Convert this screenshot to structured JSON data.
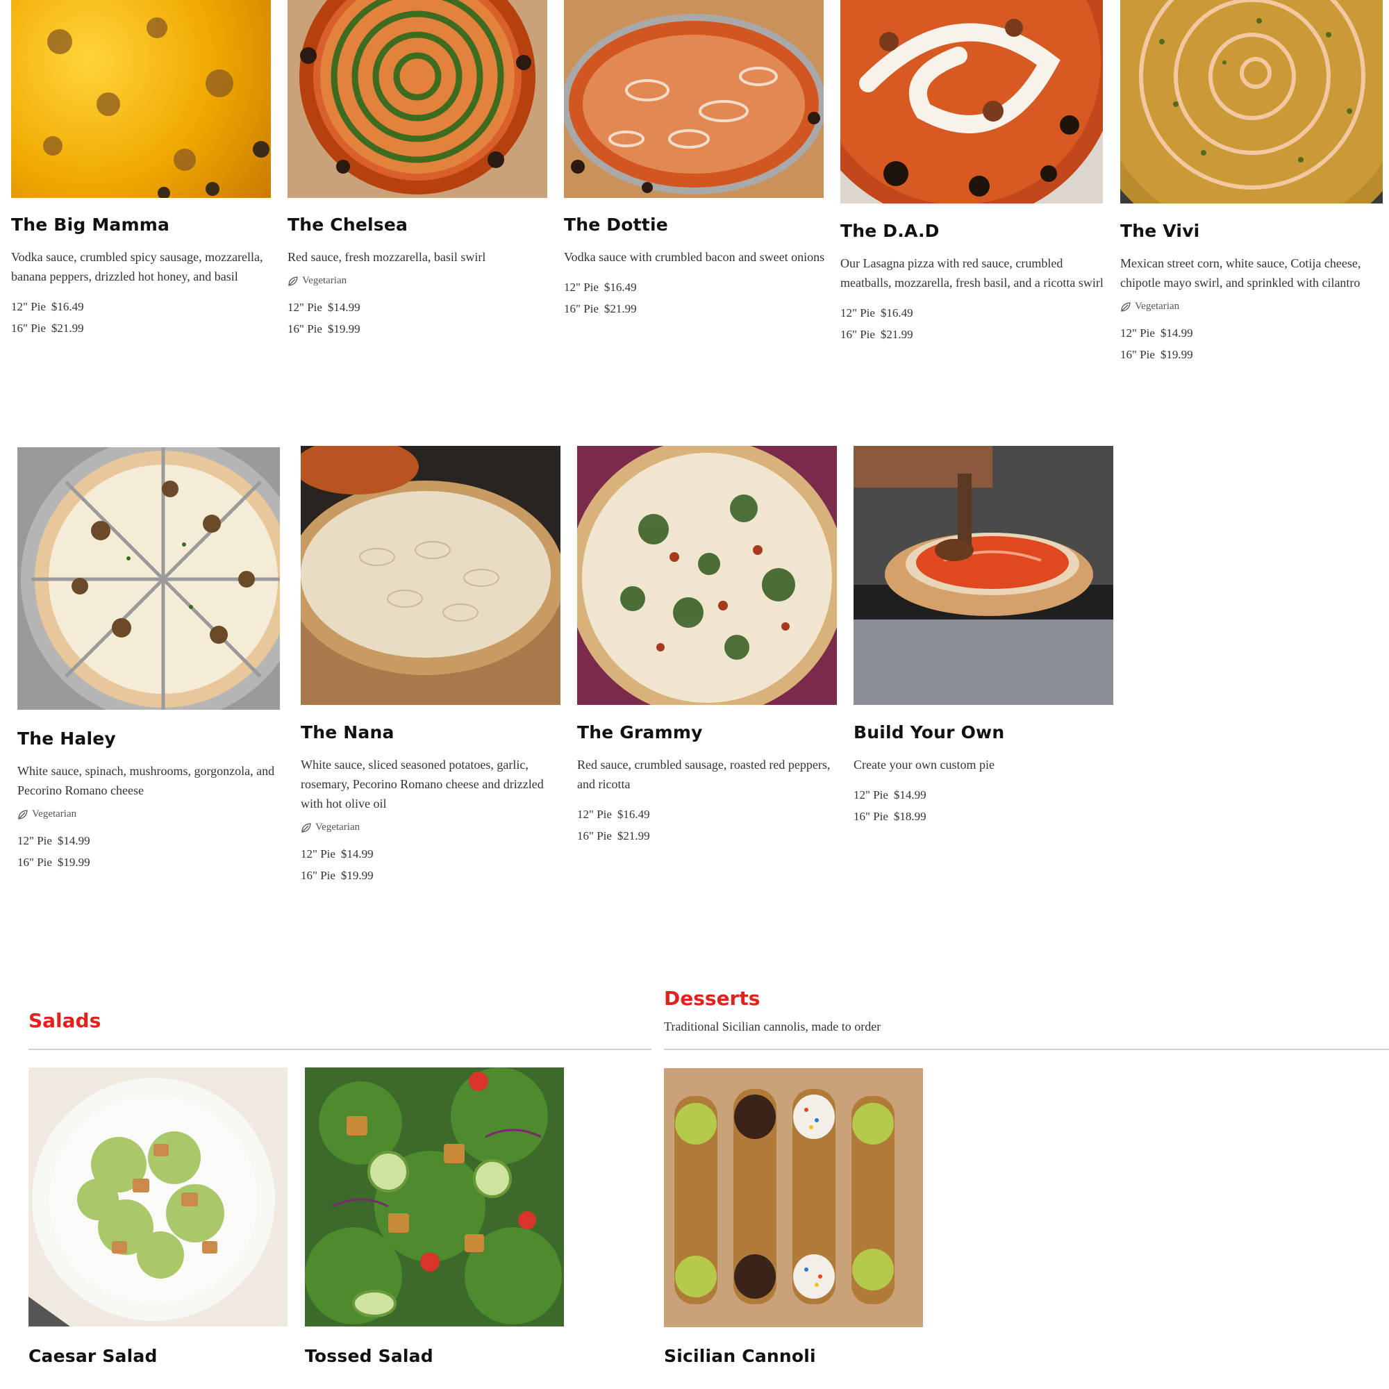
{
  "pizzas_row1": [
    {
      "name": "The Big Mamma",
      "desc": "Vodka sauce, crumbled spicy sausage, mozzarella, banana peppers, drizzled hot honey, and basil",
      "veg": "",
      "p12_label": "12\" Pie",
      "p12": "$16.49",
      "p16_label": "16\" Pie",
      "p16": "$21.99"
    },
    {
      "name": "The Chelsea",
      "desc": "Red sauce, fresh mozzarella, basil swirl",
      "veg": "Vegetarian",
      "p12_label": "12\" Pie",
      "p12": "$14.99",
      "p16_label": "16\" Pie",
      "p16": "$19.99"
    },
    {
      "name": "The Dottie",
      "desc": "Vodka sauce with crumbled bacon and sweet onions",
      "veg": "",
      "p12_label": "12\" Pie",
      "p12": "$16.49",
      "p16_label": "16\" Pie",
      "p16": "$21.99"
    },
    {
      "name": "The D.A.D",
      "desc": "Our Lasagna pizza with red sauce, crumbled meatballs, mozzarella, fresh basil, and a ricotta swirl",
      "veg": "",
      "p12_label": "12\" Pie",
      "p12": "$16.49",
      "p16_label": "16\" Pie",
      "p16": "$21.99"
    },
    {
      "name": "The Vivi",
      "desc": "Mexican street corn, white sauce, Cotija cheese, chipotle mayo swirl, and sprinkled with cilantro",
      "veg": "Vegetarian",
      "p12_label": "12\" Pie",
      "p12": "$14.99",
      "p16_label": "16\" Pie",
      "p16": "$19.99"
    }
  ],
  "pizzas_row2": [
    {
      "name": "The Haley",
      "desc": "White sauce, spinach, mushrooms, gorgonzola, and Pecorino Romano cheese",
      "veg": "Vegetarian",
      "p12_label": "12\" Pie",
      "p12": "$14.99",
      "p16_label": "16\" Pie",
      "p16": "$19.99"
    },
    {
      "name": "The Nana",
      "desc": "White sauce, sliced seasoned potatoes, garlic, rosemary, Pecorino Romano cheese and drizzled with hot olive oil",
      "veg": "Vegetarian",
      "p12_label": "12\" Pie",
      "p12": "$14.99",
      "p16_label": "16\" Pie",
      "p16": "$19.99"
    },
    {
      "name": "The Grammy",
      "desc": "Red sauce, crumbled sausage, roasted red peppers, and ricotta",
      "veg": "",
      "p12_label": "12\" Pie",
      "p12": "$16.49",
      "p16_label": "16\" Pie",
      "p16": "$21.99"
    },
    {
      "name": "Build Your Own",
      "desc": "Create your own custom pie",
      "veg": "",
      "p12_label": "12\" Pie",
      "p12": "$14.99",
      "p16_label": "16\" Pie",
      "p16": "$18.99"
    }
  ],
  "salads": {
    "title": "Salads",
    "items": [
      {
        "name": "Caesar Salad"
      },
      {
        "name": "Tossed Salad"
      }
    ]
  },
  "desserts": {
    "title": "Desserts",
    "subtitle": "Traditional Sicilian cannolis, made to order",
    "items": [
      {
        "name": "Sicilian Cannoli"
      }
    ]
  },
  "colors": {
    "accent": "#e0231c",
    "rule": "#d0d0d0"
  },
  "icons": {
    "vegetarian": "leaf-icon"
  }
}
